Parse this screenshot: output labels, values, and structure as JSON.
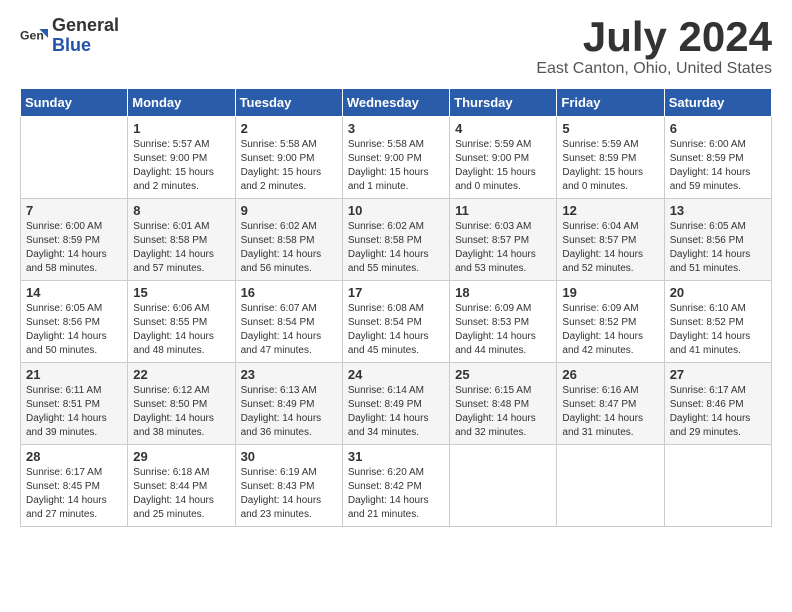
{
  "logo": {
    "general": "General",
    "blue": "Blue"
  },
  "title": "July 2024",
  "subtitle": "East Canton, Ohio, United States",
  "days_header": [
    "Sunday",
    "Monday",
    "Tuesday",
    "Wednesday",
    "Thursday",
    "Friday",
    "Saturday"
  ],
  "weeks": [
    [
      {
        "day": "",
        "info": ""
      },
      {
        "day": "1",
        "info": "Sunrise: 5:57 AM\nSunset: 9:00 PM\nDaylight: 15 hours\nand 2 minutes."
      },
      {
        "day": "2",
        "info": "Sunrise: 5:58 AM\nSunset: 9:00 PM\nDaylight: 15 hours\nand 2 minutes."
      },
      {
        "day": "3",
        "info": "Sunrise: 5:58 AM\nSunset: 9:00 PM\nDaylight: 15 hours\nand 1 minute."
      },
      {
        "day": "4",
        "info": "Sunrise: 5:59 AM\nSunset: 9:00 PM\nDaylight: 15 hours\nand 0 minutes."
      },
      {
        "day": "5",
        "info": "Sunrise: 5:59 AM\nSunset: 8:59 PM\nDaylight: 15 hours\nand 0 minutes."
      },
      {
        "day": "6",
        "info": "Sunrise: 6:00 AM\nSunset: 8:59 PM\nDaylight: 14 hours\nand 59 minutes."
      }
    ],
    [
      {
        "day": "7",
        "info": "Sunrise: 6:00 AM\nSunset: 8:59 PM\nDaylight: 14 hours\nand 58 minutes."
      },
      {
        "day": "8",
        "info": "Sunrise: 6:01 AM\nSunset: 8:58 PM\nDaylight: 14 hours\nand 57 minutes."
      },
      {
        "day": "9",
        "info": "Sunrise: 6:02 AM\nSunset: 8:58 PM\nDaylight: 14 hours\nand 56 minutes."
      },
      {
        "day": "10",
        "info": "Sunrise: 6:02 AM\nSunset: 8:58 PM\nDaylight: 14 hours\nand 55 minutes."
      },
      {
        "day": "11",
        "info": "Sunrise: 6:03 AM\nSunset: 8:57 PM\nDaylight: 14 hours\nand 53 minutes."
      },
      {
        "day": "12",
        "info": "Sunrise: 6:04 AM\nSunset: 8:57 PM\nDaylight: 14 hours\nand 52 minutes."
      },
      {
        "day": "13",
        "info": "Sunrise: 6:05 AM\nSunset: 8:56 PM\nDaylight: 14 hours\nand 51 minutes."
      }
    ],
    [
      {
        "day": "14",
        "info": "Sunrise: 6:05 AM\nSunset: 8:56 PM\nDaylight: 14 hours\nand 50 minutes."
      },
      {
        "day": "15",
        "info": "Sunrise: 6:06 AM\nSunset: 8:55 PM\nDaylight: 14 hours\nand 48 minutes."
      },
      {
        "day": "16",
        "info": "Sunrise: 6:07 AM\nSunset: 8:54 PM\nDaylight: 14 hours\nand 47 minutes."
      },
      {
        "day": "17",
        "info": "Sunrise: 6:08 AM\nSunset: 8:54 PM\nDaylight: 14 hours\nand 45 minutes."
      },
      {
        "day": "18",
        "info": "Sunrise: 6:09 AM\nSunset: 8:53 PM\nDaylight: 14 hours\nand 44 minutes."
      },
      {
        "day": "19",
        "info": "Sunrise: 6:09 AM\nSunset: 8:52 PM\nDaylight: 14 hours\nand 42 minutes."
      },
      {
        "day": "20",
        "info": "Sunrise: 6:10 AM\nSunset: 8:52 PM\nDaylight: 14 hours\nand 41 minutes."
      }
    ],
    [
      {
        "day": "21",
        "info": "Sunrise: 6:11 AM\nSunset: 8:51 PM\nDaylight: 14 hours\nand 39 minutes."
      },
      {
        "day": "22",
        "info": "Sunrise: 6:12 AM\nSunset: 8:50 PM\nDaylight: 14 hours\nand 38 minutes."
      },
      {
        "day": "23",
        "info": "Sunrise: 6:13 AM\nSunset: 8:49 PM\nDaylight: 14 hours\nand 36 minutes."
      },
      {
        "day": "24",
        "info": "Sunrise: 6:14 AM\nSunset: 8:49 PM\nDaylight: 14 hours\nand 34 minutes."
      },
      {
        "day": "25",
        "info": "Sunrise: 6:15 AM\nSunset: 8:48 PM\nDaylight: 14 hours\nand 32 minutes."
      },
      {
        "day": "26",
        "info": "Sunrise: 6:16 AM\nSunset: 8:47 PM\nDaylight: 14 hours\nand 31 minutes."
      },
      {
        "day": "27",
        "info": "Sunrise: 6:17 AM\nSunset: 8:46 PM\nDaylight: 14 hours\nand 29 minutes."
      }
    ],
    [
      {
        "day": "28",
        "info": "Sunrise: 6:17 AM\nSunset: 8:45 PM\nDaylight: 14 hours\nand 27 minutes."
      },
      {
        "day": "29",
        "info": "Sunrise: 6:18 AM\nSunset: 8:44 PM\nDaylight: 14 hours\nand 25 minutes."
      },
      {
        "day": "30",
        "info": "Sunrise: 6:19 AM\nSunset: 8:43 PM\nDaylight: 14 hours\nand 23 minutes."
      },
      {
        "day": "31",
        "info": "Sunrise: 6:20 AM\nSunset: 8:42 PM\nDaylight: 14 hours\nand 21 minutes."
      },
      {
        "day": "",
        "info": ""
      },
      {
        "day": "",
        "info": ""
      },
      {
        "day": "",
        "info": ""
      }
    ]
  ]
}
